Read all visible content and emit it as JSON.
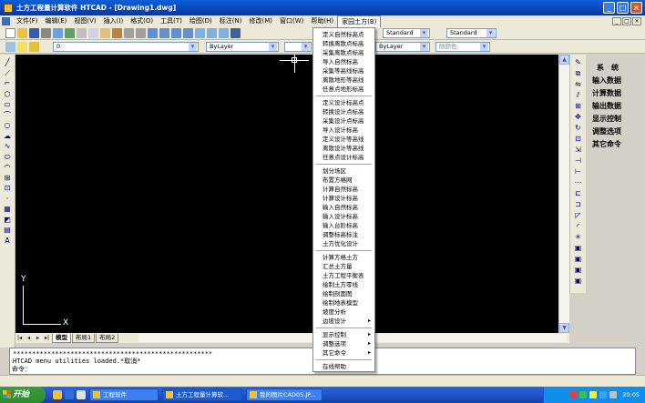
{
  "window": {
    "title": "土方工程量计算软件 HTCAD - [Drawing1.dwg]",
    "min": "_",
    "max": "□",
    "close": "×"
  },
  "menubar": {
    "items": [
      "文件(F)",
      "编辑(E)",
      "视图(V)",
      "插入(I)",
      "格式(O)",
      "工具(T)",
      "绘图(D)",
      "标注(N)",
      "修改(M)",
      "窗口(W)",
      "帮助(H)",
      "家园土方(B)"
    ],
    "active_index": 11
  },
  "toolbar": {
    "text_style": "Standard",
    "dim_style": "Standard",
    "layer": "0",
    "color": "ByLayer",
    "linetype": "ByLayer",
    "lineweight": "ByLayer",
    "plotstyle": "随颜色"
  },
  "dropdown": {
    "groups": [
      [
        "定义自然标高点",
        "转换离散点标高",
        "采集离散点标高",
        "导入自然标高",
        "采集等高线标高",
        "离散地形等高线",
        "任意点地形标高"
      ],
      [
        "定义设计标高点",
        "转换设计点标高",
        "采集设计点标高",
        "导入设计标高",
        "定义设计等高线",
        "离散设计等高线",
        "任意点设计标高"
      ],
      [
        "划分场区",
        "布置方格网",
        "计算自然标高",
        "计算设计标高",
        "输入自然标高",
        "输入设计标高",
        "输入台阶标高",
        "调整标高标注",
        "土方优化设计"
      ],
      [
        "计算方格土方",
        "汇总土方量",
        "土方工程平衡表",
        "绘制土方零线",
        "绘制剖面图",
        "绘制地表模型",
        "坡度分析",
        "边坡设计"
      ],
      [
        "显示控制",
        "调整选项",
        "其它命令"
      ],
      [
        "在线帮助"
      ]
    ],
    "submenu_items": [
      "边坡设计",
      "显示控制",
      "调整选项",
      "其它命令"
    ]
  },
  "side_menu": {
    "items": [
      "系　统",
      "输入数据",
      "计算数据",
      "输出数据",
      "显示控制",
      "调整选项",
      "其它命令"
    ]
  },
  "canvas": {
    "axis_x": "X",
    "axis_y": "Y"
  },
  "layout_tabs": [
    "模型",
    "布局1",
    "布局2"
  ],
  "command": {
    "history_line1": "****************************************************",
    "history_line2": "HTCAD menu utilities loaded.*取消*",
    "prompt": "命令："
  },
  "taskbar": {
    "start": "开始",
    "tasks": [
      "工程软件",
      "土方工程量计算软...",
      "我的图片CAD05.JP..."
    ],
    "clock": "20:05"
  }
}
